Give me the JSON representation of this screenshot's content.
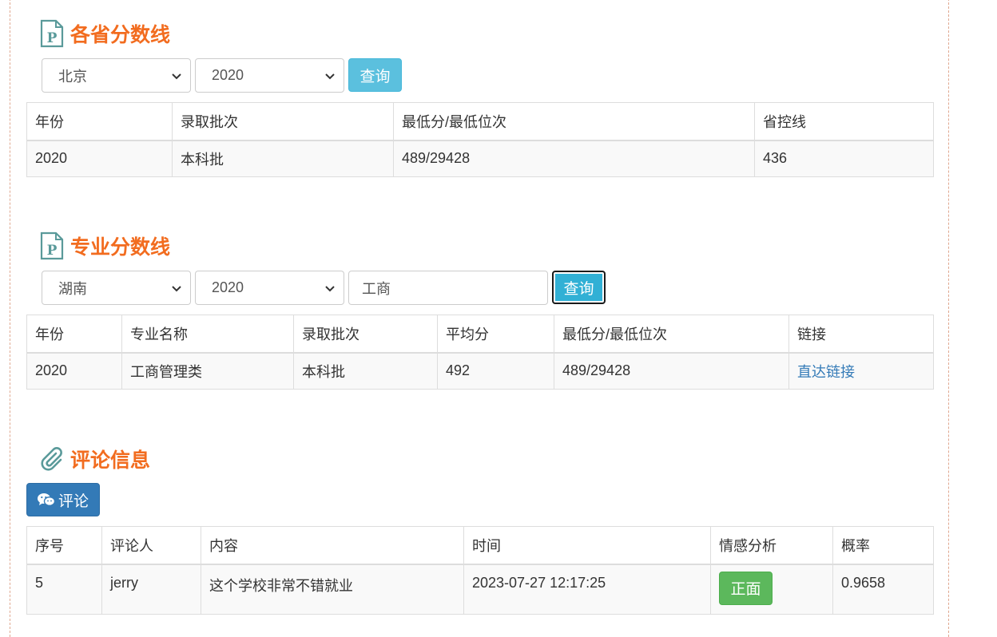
{
  "province_section": {
    "title": "各省分数线",
    "province_select": "北京",
    "year_select": "2020",
    "query_button": "查询",
    "headers": [
      "年份",
      "录取批次",
      "最低分/最低位次",
      "省控线"
    ],
    "rows": [
      [
        "2020",
        "本科批",
        "489/29428",
        "436"
      ]
    ]
  },
  "major_section": {
    "title": "专业分数线",
    "province_select": "湖南",
    "year_select": "2020",
    "keyword_value": "工商",
    "query_button": "查询",
    "headers": [
      "年份",
      "专业名称",
      "录取批次",
      "平均分",
      "最低分/最低位次",
      "链接"
    ],
    "rows": [
      [
        "2020",
        "工商管理类",
        "本科批",
        "492",
        "489/29428",
        "直达链接"
      ]
    ]
  },
  "comment_section": {
    "title": "评论信息",
    "comment_button": "评论",
    "headers": [
      "序号",
      "评论人",
      "内容",
      "时间",
      "情感分析",
      "概率"
    ],
    "rows": [
      [
        "5",
        "jerry",
        "这个学校非常不错就业",
        "2023-07-27 12:17:25",
        "正面",
        "0.9658"
      ]
    ]
  },
  "icons": {
    "section_icon": "document-p-icon",
    "comment_section_icon": "paperclip-icon",
    "comment_button_icon": "wechat-icon",
    "select_icon": "chevron-down-icon"
  },
  "colors": {
    "title_orange": "#f26c1f",
    "info_blue": "#5bc0de",
    "primary_blue": "#337ab7",
    "success_green": "#5cb85c",
    "icon_teal": "#5a9a9a"
  }
}
